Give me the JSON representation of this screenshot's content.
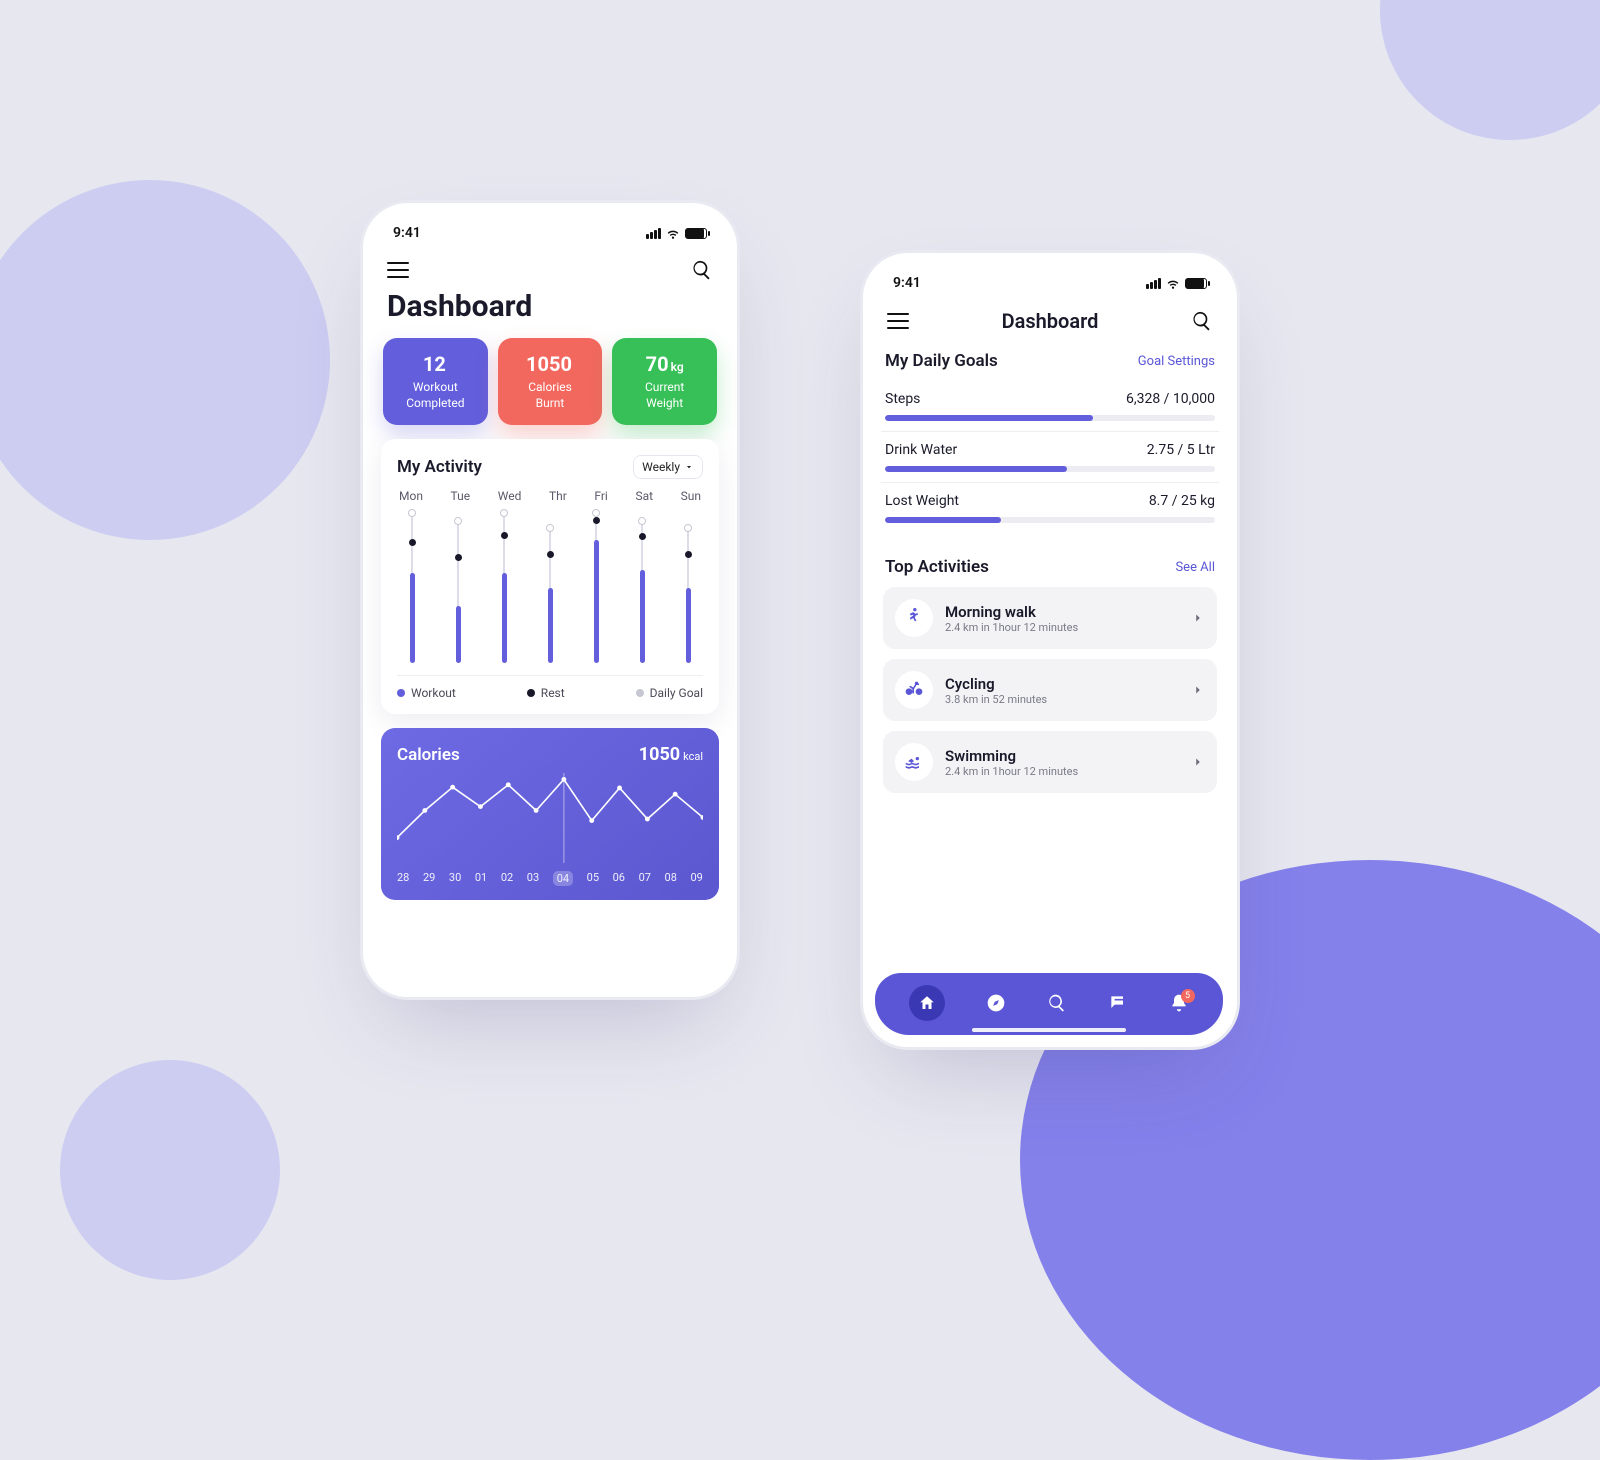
{
  "colors": {
    "accent": "#625edc",
    "red": "#f2685e",
    "green": "#38c058",
    "bg": "#e7e7f0",
    "nav": "#5a56d6"
  },
  "status": {
    "time": "9:41"
  },
  "left": {
    "title": "Dashboard",
    "stats": [
      {
        "value": "12",
        "unit": "",
        "line1": "Workout",
        "line2": "Completed",
        "color": "blue"
      },
      {
        "value": "1050",
        "unit": "",
        "line1": "Calories",
        "line2": "Burnt",
        "color": "red"
      },
      {
        "value": "70",
        "unit": "kg",
        "line1": "Current",
        "line2": "Weight",
        "color": "green"
      }
    ],
    "activity": {
      "title": "My Activity",
      "period": "Weekly",
      "days": [
        "Mon",
        "Tue",
        "Wed",
        "Thr",
        "Fri",
        "Sat",
        "Sun"
      ],
      "legend": [
        "Workout",
        "Rest",
        "Daily Goal"
      ]
    },
    "calories": {
      "title": "Calories",
      "value": "1050",
      "unit": "kcal",
      "dates": [
        "28",
        "29",
        "30",
        "01",
        "02",
        "03",
        "04",
        "05",
        "06",
        "07",
        "08",
        "09"
      ],
      "selected": "04"
    }
  },
  "right": {
    "title": "Dashboard",
    "goals": {
      "heading": "My Daily Goals",
      "settings": "Goal Settings",
      "items": [
        {
          "label": "Steps",
          "value": "6,328 / 10,000",
          "pct": 63
        },
        {
          "label": "Drink Water",
          "value": "2.75 / 5 Ltr",
          "pct": 55
        },
        {
          "label": "Lost Weight",
          "value": "8.7 / 25 kg",
          "pct": 35
        }
      ]
    },
    "top_activities": {
      "heading": "Top Activities",
      "see_all": "See All",
      "items": [
        {
          "title": "Morning walk",
          "subtitle": "2.4 km in 1hour 12 minutes",
          "icon": "run"
        },
        {
          "title": "Cycling",
          "subtitle": "3.8 km in 52 minutes",
          "icon": "bike"
        },
        {
          "title": "Swimming",
          "subtitle": "2.4 km in 1hour 12 minutes",
          "icon": "swim"
        }
      ]
    },
    "nav": {
      "badge": "5"
    }
  },
  "chart_data": [
    {
      "type": "bar",
      "title": "My Activity",
      "categories": [
        "Mon",
        "Tue",
        "Wed",
        "Thr",
        "Fri",
        "Sat",
        "Sun"
      ],
      "series": [
        {
          "name": "Daily Goal",
          "values": [
            100,
            95,
            100,
            90,
            100,
            95,
            90
          ]
        },
        {
          "name": "Workout",
          "values": [
            60,
            38,
            60,
            50,
            82,
            62,
            50
          ]
        },
        {
          "name": "Rest",
          "values": [
            80,
            70,
            85,
            72,
            95,
            84,
            72
          ]
        }
      ],
      "ylim": [
        0,
        100
      ]
    },
    {
      "type": "line",
      "title": "Calories",
      "x": [
        "28",
        "29",
        "30",
        "01",
        "02",
        "03",
        "04",
        "05",
        "06",
        "07",
        "08",
        "09"
      ],
      "values": [
        300,
        650,
        950,
        700,
        980,
        650,
        1050,
        520,
        940,
        540,
        860,
        560
      ],
      "xlabel": "",
      "ylabel": "kcal",
      "ylim": [
        0,
        1100
      ],
      "selected_x": "04",
      "selected_value": 1050
    }
  ]
}
